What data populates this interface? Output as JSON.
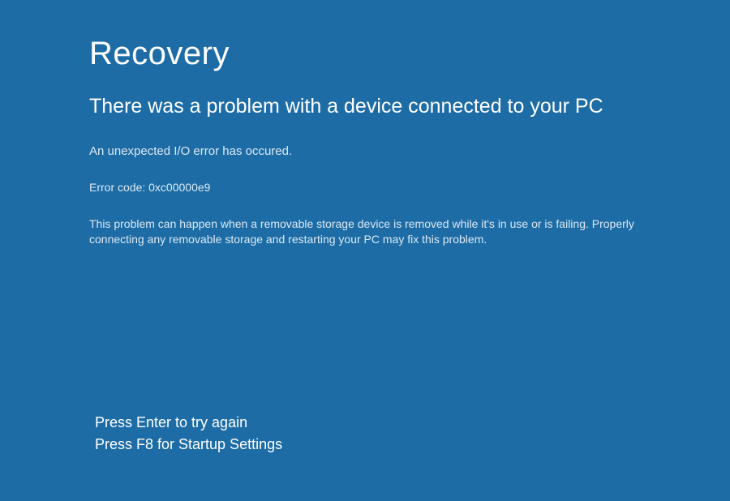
{
  "title": "Recovery",
  "subtitle": "There was a problem with a device connected to your PC",
  "message": "An unexpected I/O error has occured.",
  "error_code_line": "Error code: 0xc00000e9",
  "explanation": "This problem can happen when a removable storage device is removed while it's in use or is failing. Properly connecting any removable storage and restarting your PC may fix this problem.",
  "instructions": {
    "line1": "Press Enter to try again",
    "line2": "Press F8 for Startup Settings"
  },
  "colors": {
    "background": "#1d6ca5",
    "text": "#ffffff",
    "muted_text": "#dbe9f4"
  }
}
